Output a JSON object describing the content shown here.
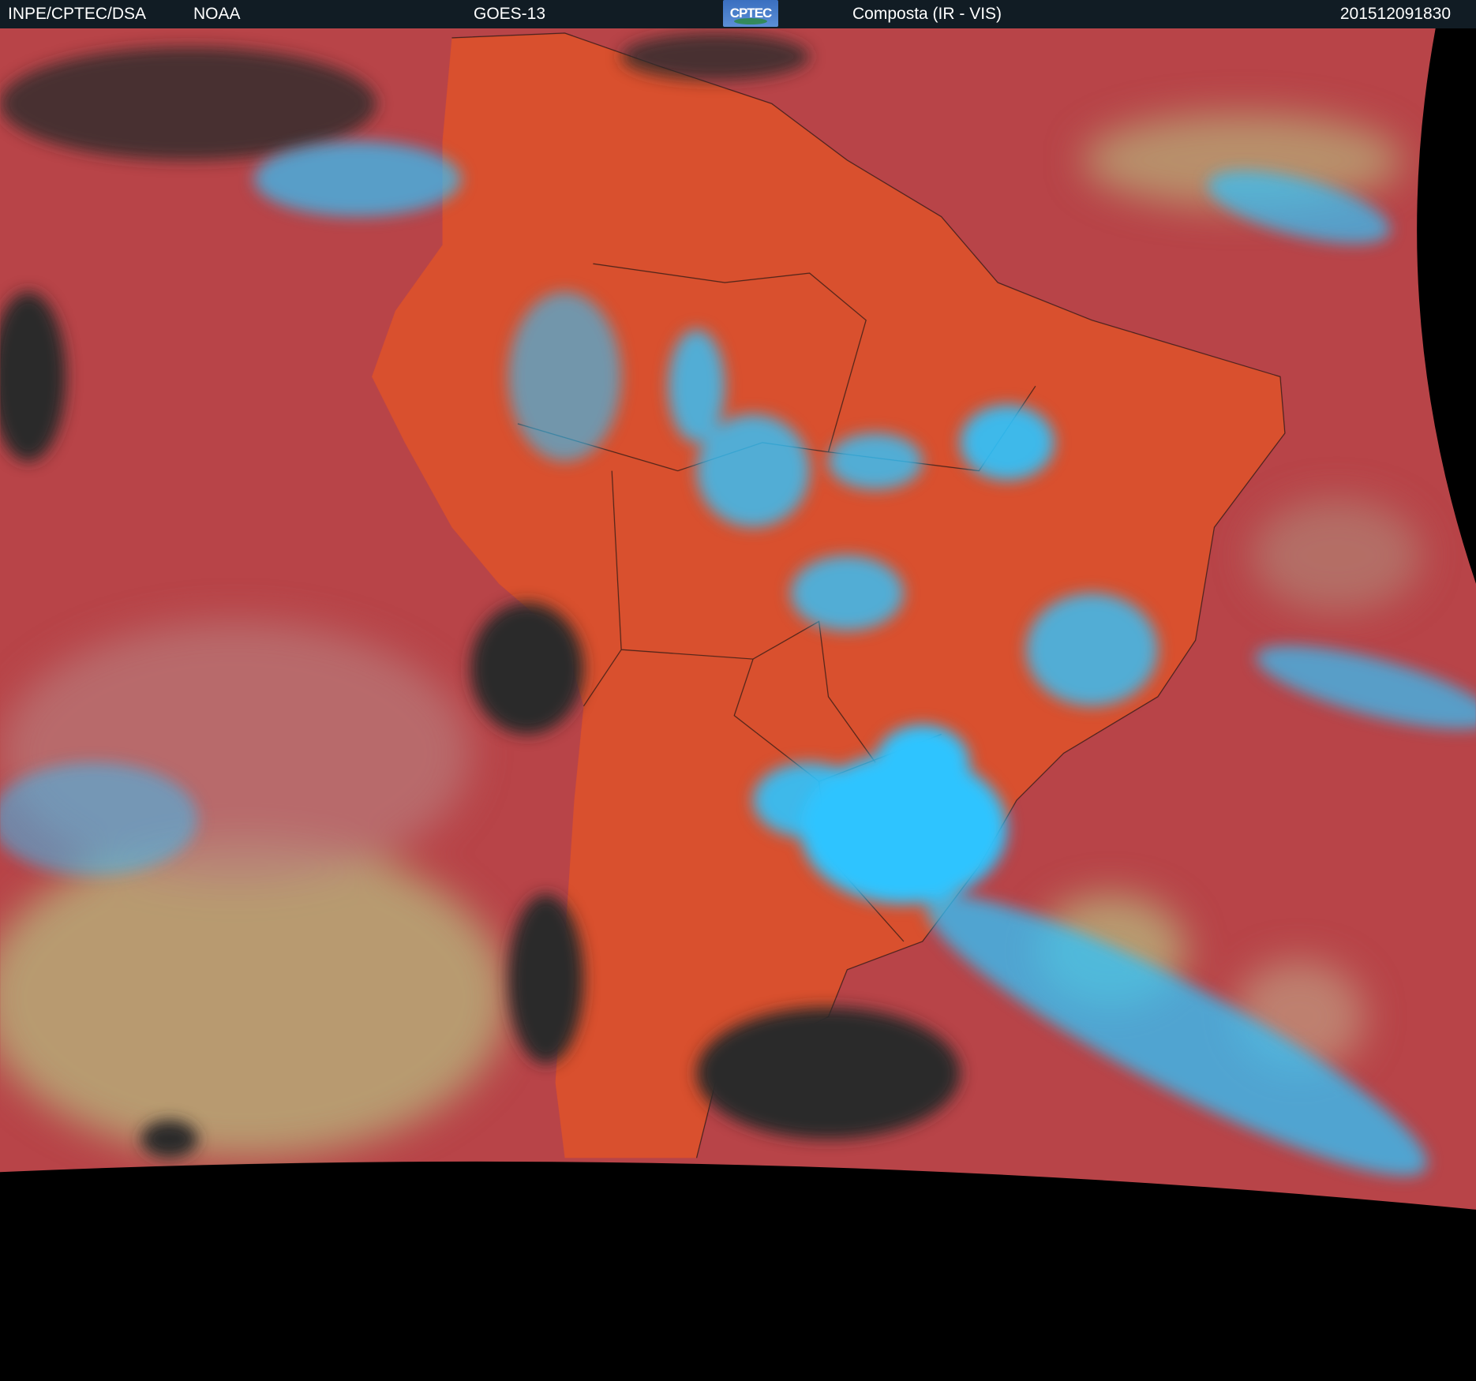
{
  "header": {
    "institution": "INPE/CPTEC/DSA",
    "agency": "NOAA",
    "satellite": "GOES-13",
    "logo_text": "CPTEC",
    "product": "Composta (IR - VIS)",
    "timestamp": "201512091830"
  },
  "colors": {
    "header_bg": "#111c24",
    "ocean": "#b84448",
    "land": "#d9502e",
    "cloud_high": "#2fc4ff",
    "clear_dark": "#2a2a2c",
    "low_cloud": "#b8b07a"
  }
}
